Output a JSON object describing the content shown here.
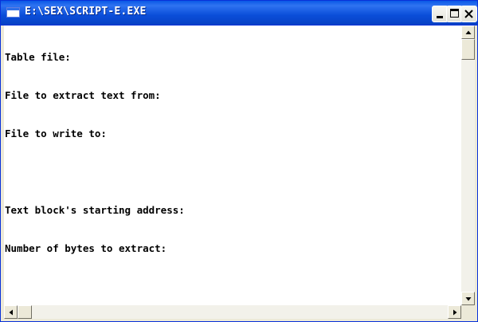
{
  "window": {
    "title": "E:\\SEX\\SCRIPT-E.EXE"
  },
  "caption_buttons": {
    "minimize": "minimize-icon",
    "maximize": "maximize-icon",
    "close": "close-icon"
  },
  "console": {
    "lines": [
      "Table file:",
      "File to extract text from:",
      "File to write to:",
      "",
      "Text block's starting address:",
      "Number of bytes to extract:"
    ]
  }
}
